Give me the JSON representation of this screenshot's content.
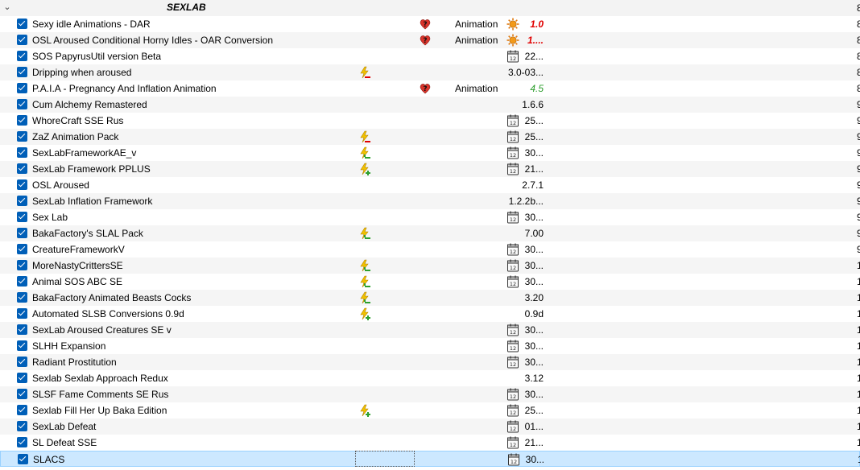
{
  "separator": {
    "title": "SEXLAB",
    "priority": "8"
  },
  "rows": [
    {
      "name": "Sexy idle Animations - DAR",
      "flag": "",
      "content": "heart-question",
      "category": "Animation",
      "version_icon": "sun-warning",
      "version": "1.0",
      "version_style": "red",
      "priority": "8"
    },
    {
      "name": "OSL Aroused Conditional Horny Idles - OAR Conversion",
      "flag": "",
      "content": "heart-question",
      "category": "Animation",
      "version_icon": "sun-warning",
      "version": "1....",
      "version_style": "red",
      "priority": "8"
    },
    {
      "name": "SOS PapyrusUtil version Beta",
      "flag": "",
      "content": "",
      "category": "",
      "version_icon": "calendar",
      "version": "22...",
      "version_style": "",
      "priority": "8"
    },
    {
      "name": "Dripping when aroused",
      "flag": "flash-red",
      "content": "",
      "category": "",
      "version_icon": "",
      "version": "3.0-03...",
      "version_style": "",
      "priority": "8"
    },
    {
      "name": "P.A.I.A - Pregnancy And Inflation Animation",
      "flag": "",
      "content": "heart-question",
      "category": "Animation",
      "version_icon": "",
      "version": "4.5",
      "version_style": "green",
      "priority": "8"
    },
    {
      "name": "Cum Alchemy Remastered",
      "flag": "",
      "content": "",
      "category": "",
      "version_icon": "",
      "version": "1.6.6",
      "version_style": "",
      "priority": "9"
    },
    {
      "name": "WhoreCraft SSE Rus",
      "flag": "",
      "content": "",
      "category": "",
      "version_icon": "calendar",
      "version": "25...",
      "version_style": "",
      "priority": "9"
    },
    {
      "name": "ZaZ Animation Pack",
      "flag": "flash-red",
      "content": "",
      "category": "",
      "version_icon": "calendar",
      "version": "25...",
      "version_style": "",
      "priority": "9"
    },
    {
      "name": "SexLabFrameworkAE_v",
      "flag": "flash-green",
      "content": "",
      "category": "",
      "version_icon": "calendar",
      "version": "30...",
      "version_style": "",
      "priority": "9"
    },
    {
      "name": "SexLab Framework PPLUS",
      "flag": "flash-plus",
      "content": "",
      "category": "",
      "version_icon": "calendar",
      "version": "21...",
      "version_style": "",
      "priority": "9"
    },
    {
      "name": "OSL Aroused",
      "flag": "",
      "content": "",
      "category": "",
      "version_icon": "",
      "version": "2.7.1",
      "version_style": "",
      "priority": "9"
    },
    {
      "name": "SexLab Inflation Framework",
      "flag": "",
      "content": "",
      "category": "",
      "version_icon": "",
      "version": "1.2.2b...",
      "version_style": "",
      "priority": "9"
    },
    {
      "name": "Sex Lab",
      "flag": "",
      "content": "",
      "category": "",
      "version_icon": "calendar",
      "version": "30...",
      "version_style": "",
      "priority": "9"
    },
    {
      "name": "BakaFactory's SLAL Pack",
      "flag": "flash-green",
      "content": "",
      "category": "",
      "version_icon": "",
      "version": "7.00",
      "version_style": "",
      "priority": "9"
    },
    {
      "name": "CreatureFrameworkV",
      "flag": "",
      "content": "",
      "category": "",
      "version_icon": "calendar",
      "version": "30...",
      "version_style": "",
      "priority": "9"
    },
    {
      "name": "MoreNastyCrittersSE",
      "flag": "flash-green",
      "content": "",
      "category": "",
      "version_icon": "calendar",
      "version": "30...",
      "version_style": "",
      "priority": "1"
    },
    {
      "name": "Animal SOS ABC SE",
      "flag": "flash-green",
      "content": "",
      "category": "",
      "version_icon": "calendar",
      "version": "30...",
      "version_style": "",
      "priority": "1"
    },
    {
      "name": "BakaFactory Animated Beasts Cocks",
      "flag": "flash-green",
      "content": "",
      "category": "",
      "version_icon": "",
      "version": "3.20",
      "version_style": "",
      "priority": "1"
    },
    {
      "name": "Automated SLSB Conversions 0.9d",
      "flag": "flash-plus",
      "content": "",
      "category": "",
      "version_icon": "",
      "version": "0.9d",
      "version_style": "",
      "priority": "1"
    },
    {
      "name": "SexLab Aroused Creatures SE v",
      "flag": "",
      "content": "",
      "category": "",
      "version_icon": "calendar",
      "version": "30...",
      "version_style": "",
      "priority": "1"
    },
    {
      "name": "SLHH Expansion",
      "flag": "",
      "content": "",
      "category": "",
      "version_icon": "calendar",
      "version": "30...",
      "version_style": "",
      "priority": "1"
    },
    {
      "name": "Radiant Prostitution",
      "flag": "",
      "content": "",
      "category": "",
      "version_icon": "calendar",
      "version": "30...",
      "version_style": "",
      "priority": "1"
    },
    {
      "name": "Sexlab Sexlab Approach Redux",
      "flag": "",
      "content": "",
      "category": "",
      "version_icon": "",
      "version": "3.12",
      "version_style": "",
      "priority": "1"
    },
    {
      "name": "SLSF Fame Comments SE Rus",
      "flag": "",
      "content": "",
      "category": "",
      "version_icon": "calendar",
      "version": "30...",
      "version_style": "",
      "priority": "1"
    },
    {
      "name": "Sexlab Fill Her Up Baka Edition",
      "flag": "flash-plus",
      "content": "",
      "category": "",
      "version_icon": "calendar",
      "version": "25...",
      "version_style": "",
      "priority": "1"
    },
    {
      "name": "SexLab Defeat",
      "flag": "",
      "content": "",
      "category": "",
      "version_icon": "calendar",
      "version": "01...",
      "version_style": "",
      "priority": "1"
    },
    {
      "name": "SL Defeat SSE",
      "flag": "",
      "content": "",
      "category": "",
      "version_icon": "calendar",
      "version": "21...",
      "version_style": "",
      "priority": "1"
    },
    {
      "name": "SLACS",
      "flag": "",
      "content": "",
      "category": "",
      "version_icon": "calendar",
      "version": "30...",
      "version_style": "",
      "priority": "1",
      "selected": true
    }
  ]
}
